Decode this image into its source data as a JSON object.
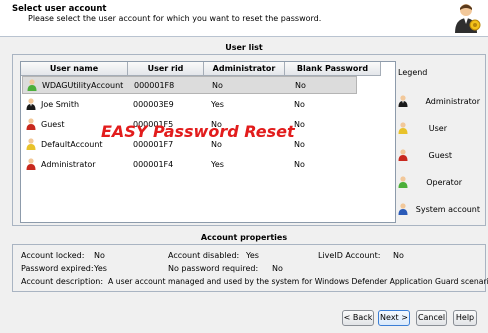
{
  "header": {
    "title": "Select user account",
    "subtitle": "Please select the user account for which you want to reset the password."
  },
  "user_list": {
    "title": "User list",
    "columns": [
      "User name",
      "User rid",
      "Administrator",
      "Blank Password"
    ],
    "rows": [
      {
        "name": "WDAGUtilityAccount",
        "rid": "000001F8",
        "administrator": "No",
        "blank_password": "No",
        "type": "operator",
        "selected": true
      },
      {
        "name": "Joe Smith",
        "rid": "000003E9",
        "administrator": "Yes",
        "blank_password": "No",
        "type": "administrator",
        "selected": false
      },
      {
        "name": "Guest",
        "rid": "000001F5",
        "administrator": "No",
        "blank_password": "No",
        "type": "guest",
        "selected": false
      },
      {
        "name": "DefaultAccount",
        "rid": "000001F7",
        "administrator": "No",
        "blank_password": "No",
        "type": "user",
        "selected": false
      },
      {
        "name": "Administrator",
        "rid": "000001F4",
        "administrator": "Yes",
        "blank_password": "No",
        "type": "guest",
        "selected": false
      }
    ],
    "watermark": "EASY Password Reset"
  },
  "legend": {
    "title": "Legend",
    "items": [
      "Administrator",
      "User",
      "Guest",
      "Operator",
      "System account"
    ]
  },
  "account_properties": {
    "title": "Account properties",
    "locked_label": "Account locked:",
    "locked_value": "No",
    "disabled_label": "Account disabled:",
    "disabled_value": "Yes",
    "liveid_label": "LiveID Account:",
    "liveid_value": "No",
    "expired_label": "Password expired:",
    "expired_value": "Yes",
    "nopwd_label": "No password required:",
    "nopwd_value": "No",
    "description_label": "Account description:",
    "description_value": "A user account managed and used by the system for Windows Defender Application Guard scenarios."
  },
  "buttons": {
    "back": "< Back",
    "next": "Next >",
    "cancel": "Cancel",
    "help": "Help"
  },
  "colors": {
    "administrator": "#1a1a1a",
    "user": "#e8c22a",
    "guest": "#c8281e",
    "operator": "#4caf3a",
    "system": "#2a5ab8",
    "watermark": "#e21c1c"
  }
}
